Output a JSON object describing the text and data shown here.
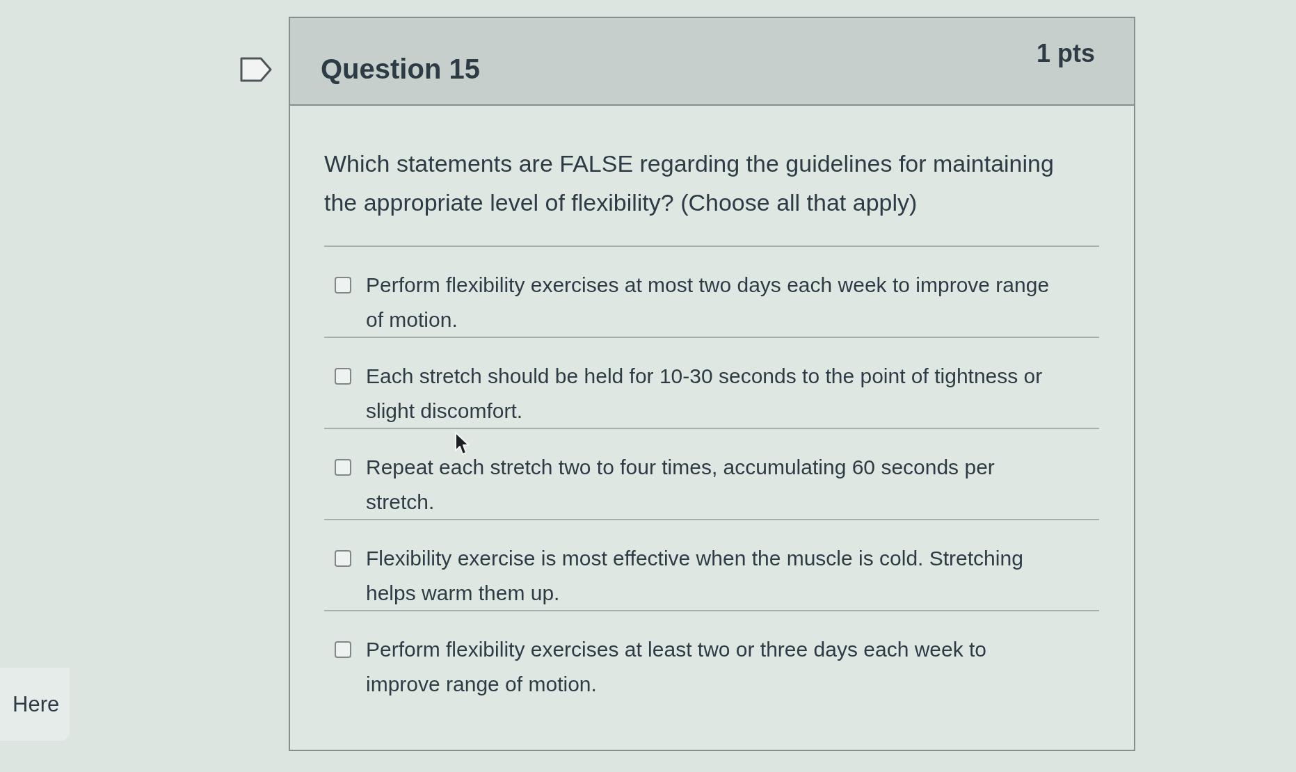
{
  "sidebar": {
    "link": "Here"
  },
  "question": {
    "title": "Question 15",
    "points": "1 pts",
    "prompt": "Which statements are FALSE regarding the guidelines for maintaining the appropriate level of flexibility? (Choose all that apply)",
    "answers": [
      {
        "text": "Perform flexibility exercises at most two days each week to improve range of motion.",
        "checked": false
      },
      {
        "text": "Each stretch should be held for 10-30 seconds to the point of tightness or slight discomfort.",
        "checked": false
      },
      {
        "text": "Repeat each stretch two to four times, accumulating 60 seconds per stretch.",
        "checked": false
      },
      {
        "text": "Flexibility exercise is most effective when the muscle is cold. Stretching helps warm them up.",
        "checked": false
      },
      {
        "text": "Perform flexibility exercises at least two or three days each week to improve range of motion.",
        "checked": false
      }
    ]
  }
}
